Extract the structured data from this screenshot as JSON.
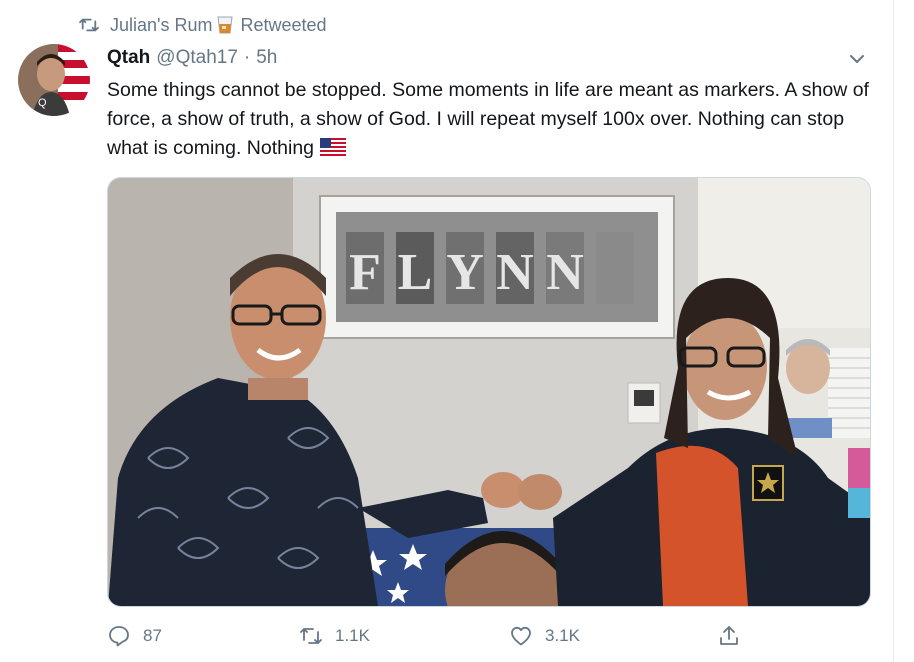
{
  "retweet_context": {
    "user": "Julian's Rum",
    "status": "Retweeted"
  },
  "tweet": {
    "name": "Qtah",
    "handle": "@Qtah17",
    "separator": "·",
    "time": "5h",
    "text": "Some things cannot be stopped. Some moments in life are meant as markers. A show of force, a show of truth, a show of God. I will repeat myself 100x over. Nothing can stop what is coming. Nothing"
  },
  "media": {
    "frame_letters": [
      "F",
      "L",
      "Y",
      "N",
      "N"
    ]
  },
  "actions": {
    "replies": "87",
    "retweets": "1.1K",
    "likes": "3.1K"
  },
  "icons": [
    "retweet-icon",
    "glass-emoji-icon",
    "caret-down-icon",
    "us-flag-icon",
    "reply-icon",
    "retweet-action-icon",
    "like-icon",
    "share-icon"
  ],
  "colors": {
    "secondary_text": "#657786",
    "border": "#ccd6dd"
  }
}
